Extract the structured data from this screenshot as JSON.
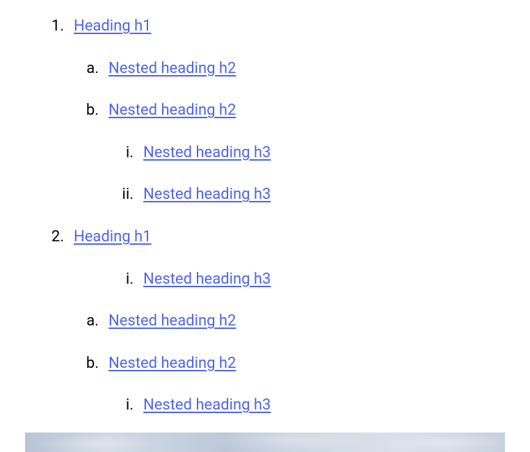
{
  "toc": [
    {
      "level": 1,
      "marker": "1.",
      "label": "Heading h1"
    },
    {
      "level": 2,
      "marker": "a.",
      "label": "Nested heading h2"
    },
    {
      "level": 2,
      "marker": "b.",
      "label": "Nested heading h2"
    },
    {
      "level": 3,
      "marker": "i.",
      "label": "Nested heading h3"
    },
    {
      "level": 3,
      "marker": "ii.",
      "label": "Nested heading h3"
    },
    {
      "level": 1,
      "marker": "2.",
      "label": "Heading h1"
    },
    {
      "level": 3,
      "marker": "i.",
      "label": "Nested heading h3"
    },
    {
      "level": 2,
      "marker": "a.",
      "label": "Nested heading h2"
    },
    {
      "level": 2,
      "marker": "b.",
      "label": "Nested heading h2"
    },
    {
      "level": 3,
      "marker": "i.",
      "label": "Nested heading h3"
    }
  ],
  "link_color": "#4f65e8"
}
